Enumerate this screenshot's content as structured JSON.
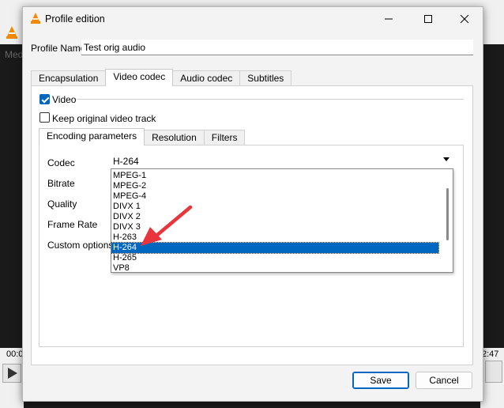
{
  "background_app": {
    "menu_text": "Med",
    "time_left": "00:0",
    "time_right": "2:47"
  },
  "dialog": {
    "title": "Profile edition",
    "profile_name_label": "Profile Name",
    "profile_name_value": "Test orig audio",
    "tabs": [
      "Encapsulation",
      "Video codec",
      "Audio codec",
      "Subtitles"
    ],
    "active_tab": "Video codec",
    "video_checkbox_label": "Video",
    "video_checked": true,
    "keep_original_label": "Keep original video track",
    "keep_original_checked": false,
    "subtabs": [
      "Encoding parameters",
      "Resolution",
      "Filters"
    ],
    "active_subtab": "Encoding parameters",
    "fields": {
      "codec_label": "Codec",
      "bitrate_label": "Bitrate",
      "quality_label": "Quality",
      "frame_rate_label": "Frame Rate",
      "custom_options_label": "Custom options"
    },
    "codec_selected": "H-264",
    "codec_options": [
      "MPEG-1",
      "MPEG-2",
      "MPEG-4",
      "DIVX 1",
      "DIVX 2",
      "DIVX 3",
      "H-263",
      "H-264",
      "H-265",
      "VP8"
    ],
    "buttons": {
      "save": "Save",
      "cancel": "Cancel"
    }
  },
  "colors": {
    "accent": "#0067c0",
    "annotation_arrow": "#e8343a"
  }
}
